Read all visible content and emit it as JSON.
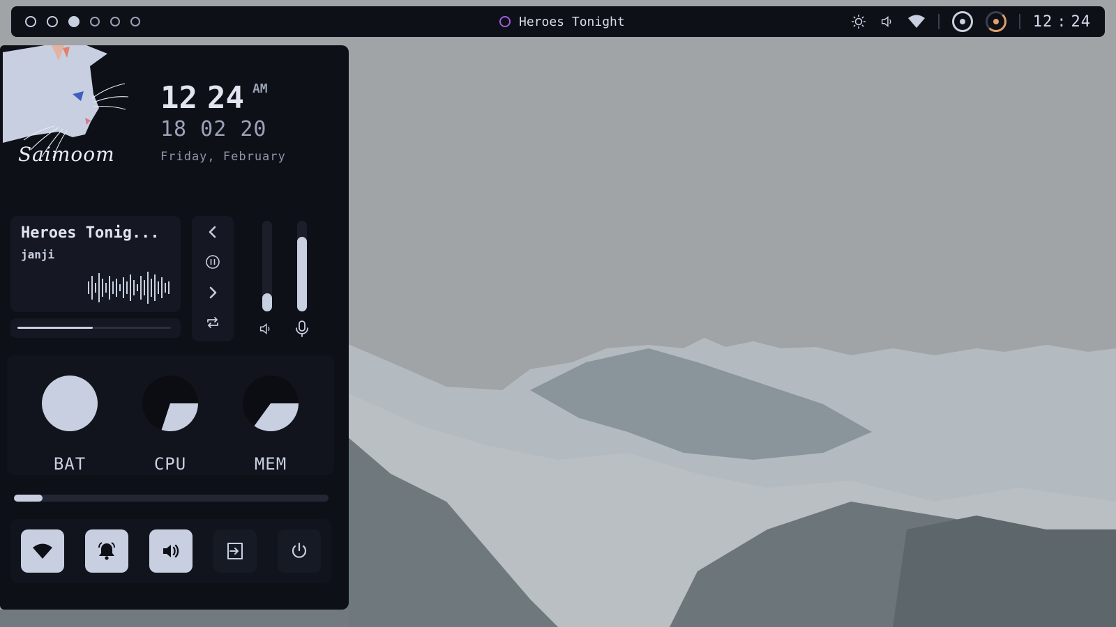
{
  "workspaces": [
    {
      "state": "open"
    },
    {
      "state": "open"
    },
    {
      "state": "active"
    },
    {
      "state": "empty"
    },
    {
      "state": "empty"
    },
    {
      "state": "empty"
    }
  ],
  "topbar": {
    "now_playing": "Heroes Tonight",
    "tray_icons": [
      "brightness-icon",
      "volume-icon",
      "wifi-icon",
      "record-icon",
      "theme-icon"
    ],
    "time_hour": "12",
    "time_sep": ":",
    "time_minute": "24"
  },
  "profile": {
    "signature": "Saimoom"
  },
  "clock": {
    "hour": "12",
    "minute": "24",
    "ampm": "AM",
    "date": "18 02 20",
    "day": "Friday, February"
  },
  "music": {
    "title": "Heroes Tonig...",
    "artist": "janji",
    "progress": 0.49,
    "controls": [
      "previous-icon",
      "pause-icon",
      "next-icon",
      "repeat-icon"
    ]
  },
  "audio": {
    "volume_level": 0.2,
    "mic_level": 0.82
  },
  "stats": [
    {
      "label": "BAT",
      "value": 100
    },
    {
      "label": "CPU",
      "value": 30
    },
    {
      "label": "MEM",
      "value": 35
    }
  ],
  "brightness": {
    "level": 0.09
  },
  "toggles": [
    {
      "name": "wifi-icon",
      "state": "on"
    },
    {
      "name": "notifications-icon",
      "state": "on"
    },
    {
      "name": "sound-icon",
      "state": "on"
    },
    {
      "name": "logout-icon",
      "state": "off"
    },
    {
      "name": "power-icon",
      "state": "off"
    }
  ],
  "colors": {
    "panel": "#0e1017",
    "card": "#151822",
    "accent": "#c8cfe0",
    "now_playing_ring": "#a35ed9",
    "theme_ring": "#e0a06a"
  }
}
